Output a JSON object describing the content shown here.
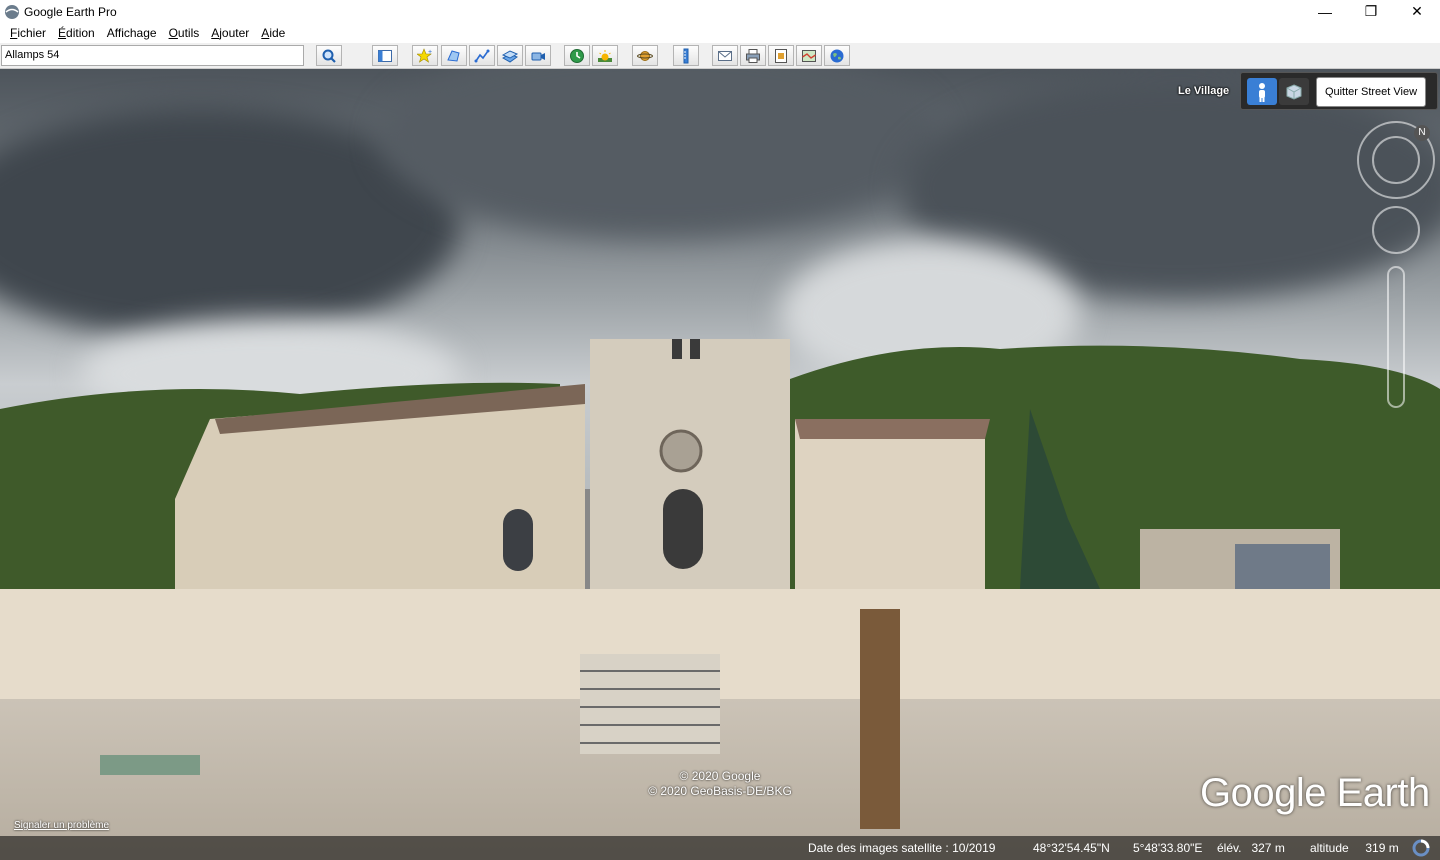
{
  "window": {
    "title": "Google Earth Pro",
    "controls": {
      "minimize": "—",
      "restore": "❐",
      "close": "✕"
    }
  },
  "menu": {
    "items": [
      {
        "label": "Fichier",
        "accel": "F",
        "rest": "ichier"
      },
      {
        "label": "Édition",
        "accel": "É",
        "rest": "dition"
      },
      {
        "label": "Affichage",
        "accel": "",
        "rest": "Affichage"
      },
      {
        "label": "Outils",
        "accel": "O",
        "rest": "utils"
      },
      {
        "label": "Ajouter",
        "accel": "A",
        "rest": "jouter"
      },
      {
        "label": "Aide",
        "accel": "A",
        "rest": "ide"
      }
    ]
  },
  "toolbar": {
    "search_value": "Allamps 54",
    "buttons": [
      "search-icon",
      "sidebar-icon",
      "placemark-icon",
      "polygon-icon",
      "path-icon",
      "overlay-icon",
      "tour-icon",
      "historical-imagery-icon",
      "sunlight-icon",
      "planets-icon",
      "ruler-icon",
      "email-icon",
      "print-icon",
      "save-image-icon",
      "maps-icon",
      "earth-icon"
    ]
  },
  "streetview": {
    "location_label": "Le Village",
    "quit_label": "Quitter Street View",
    "compass_north": "N"
  },
  "overlay": {
    "copyright_1": "© 2020 Google",
    "copyright_2": "© 2020 GeoBasis-DE/BKG",
    "report_link": "Signaler un problème",
    "logo": "Google Earth"
  },
  "status": {
    "imagery_date": "Date des images satellite : 10/2019",
    "latitude": "48°32'54.45\"N",
    "longitude": "5°48'33.80\"E",
    "elevation": "élév.   327 m",
    "altitude": "altitude     319 m"
  },
  "colors": {
    "accent": "#3a7fd5",
    "toolbar_bg": "#f0f0f0"
  }
}
